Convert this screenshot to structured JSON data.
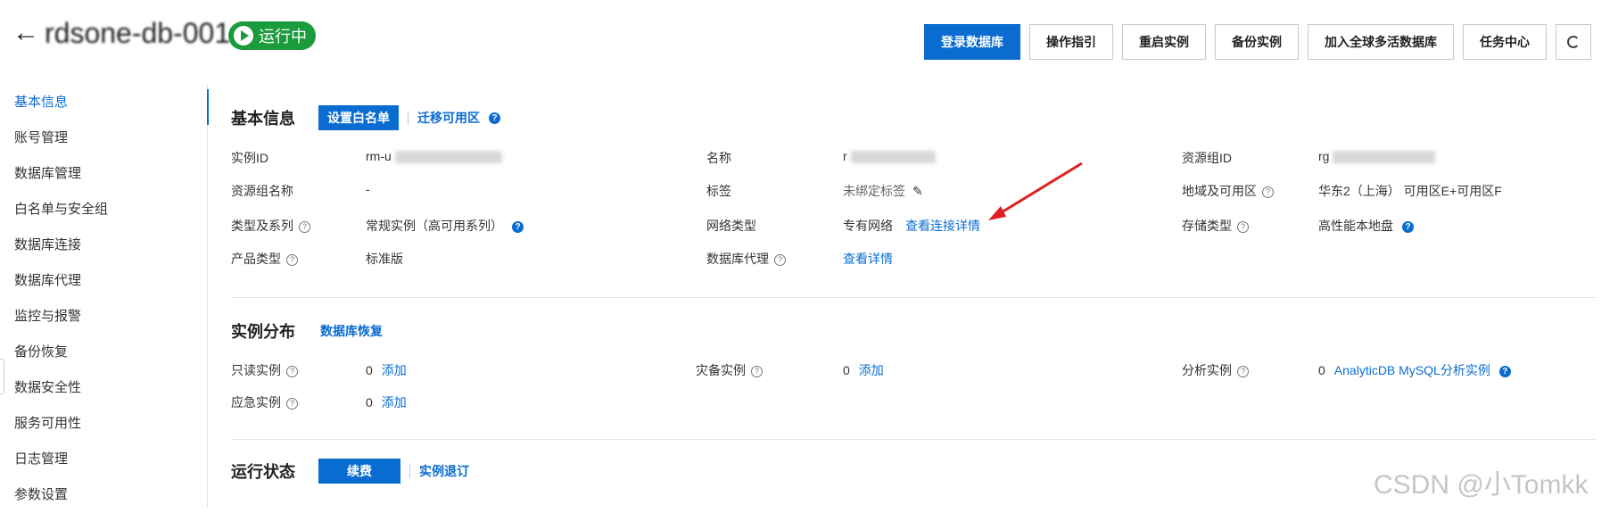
{
  "header": {
    "instance_name": "rdsone-db-001",
    "status": "运行中",
    "actions": [
      "登录数据库",
      "操作指引",
      "重启实例",
      "备份实例",
      "加入全球多活数据库",
      "任务中心"
    ]
  },
  "sidebar": {
    "items": [
      "基本信息",
      "账号管理",
      "数据库管理",
      "白名单与安全组",
      "数据库连接",
      "数据库代理",
      "监控与报警",
      "备份恢复",
      "数据安全性",
      "服务可用性",
      "日志管理",
      "参数设置"
    ]
  },
  "basic_info": {
    "title": "基本信息",
    "whitelist_button": "设置白名单",
    "migrate_link": "迁移可用区",
    "instance_id_label": "实例ID",
    "instance_id_value": "rm-u",
    "name_label": "名称",
    "name_value": "r",
    "rg_id_label": "资源组ID",
    "rg_id_value": "rg",
    "rg_name_label": "资源组名称",
    "rg_name_value": "-",
    "tag_label": "标签",
    "tag_value": "未绑定标签",
    "region_label": "地域及可用区",
    "region_value": "华东2（上海） 可用区E+可用区F",
    "type_label": "类型及系列",
    "type_value": "常规实例（高可用系列）",
    "network_label": "网络类型",
    "network_value": "专有网络",
    "network_link": "查看连接详情",
    "storage_label": "存储类型",
    "storage_value": "高性能本地盘",
    "product_label": "产品类型",
    "product_value": "标准版",
    "proxy_label": "数据库代理",
    "proxy_link": "查看详情"
  },
  "distribution": {
    "title": "实例分布",
    "restore_link": "数据库恢复",
    "readonly_label": "只读实例",
    "readonly_count": "0",
    "disaster_label": "灾备实例",
    "disaster_count": "0",
    "analytic_label": "分析实例",
    "analytic_count": "0",
    "analytic_link": "AnalyticDB MySQL分析实例",
    "emergency_label": "应急实例",
    "emergency_count": "0",
    "add_link": "添加"
  },
  "running": {
    "title": "运行状态",
    "renew_button": "续费",
    "refund_link": "实例退订"
  },
  "watermark": "CSDN @小Tomkk",
  "colors": {
    "primary": "#0a6cd1",
    "running": "#1a9b3c",
    "annotation": "#e02020"
  }
}
